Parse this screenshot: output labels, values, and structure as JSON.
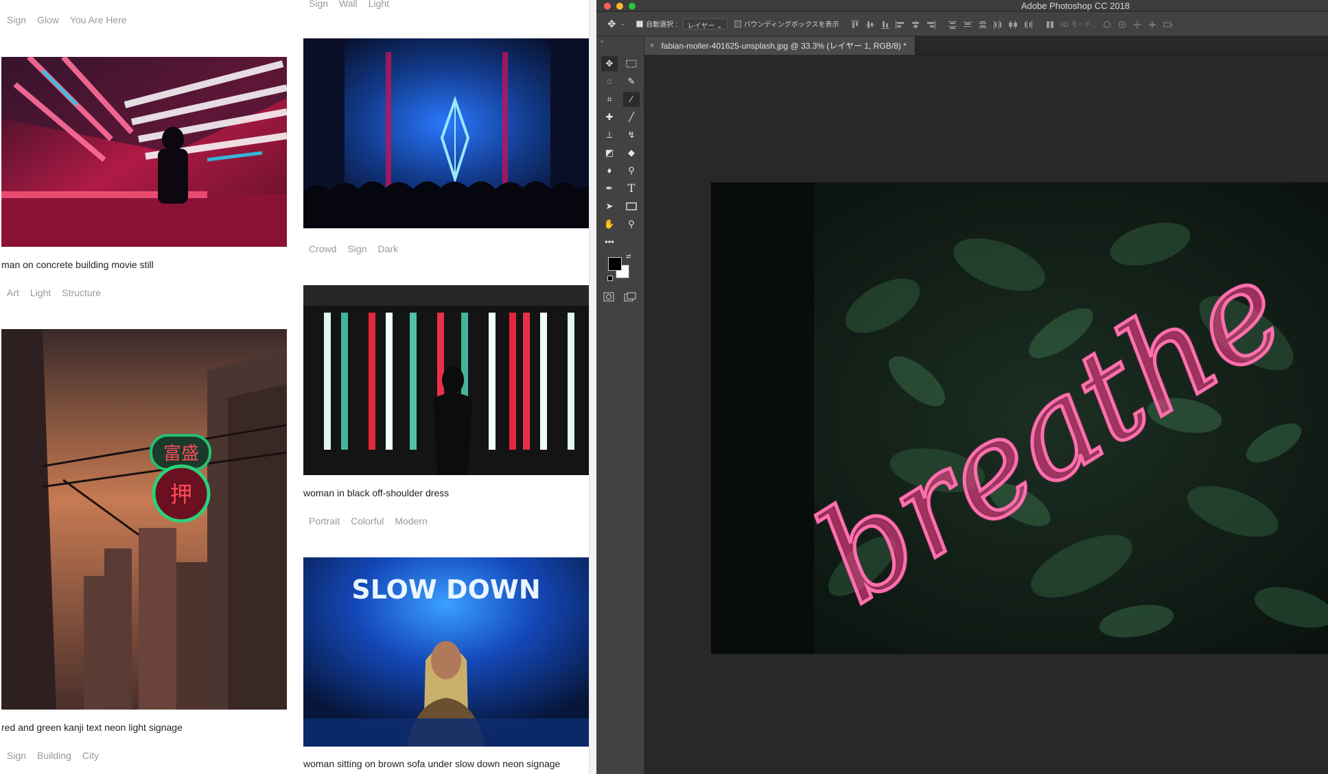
{
  "gallery": {
    "left_column": {
      "top_tags": [
        "Sign",
        "Glow",
        "You Are Here"
      ],
      "items": [
        {
          "caption": "man on concrete building movie still",
          "tags": [
            "Art",
            "Light",
            "Structure"
          ]
        },
        {
          "caption": "red and green kanji text neon light signage",
          "tags": [
            "Sign",
            "Building",
            "City"
          ]
        }
      ]
    },
    "right_column": {
      "top_tags": [
        "Sign",
        "Wall",
        "Light"
      ],
      "items": [
        {
          "tags": [
            "Crowd",
            "Sign",
            "Dark"
          ]
        },
        {
          "caption": "woman in black off-shoulder dress",
          "tags": [
            "Portrait",
            "Colorful",
            "Modern"
          ]
        },
        {
          "caption": "woman sitting on brown sofa under slow down neon signage",
          "sign_text": "SLOW DOWN"
        }
      ]
    }
  },
  "photoshop": {
    "title": "Adobe Photoshop CC 2018",
    "options_bar": {
      "auto_select_label": "自動選択 :",
      "auto_select_value": "レイヤー",
      "bounding_box_label": "バウンディングボックスを表示",
      "mode_3d_label": "3D モード :"
    },
    "document_tab": "fabian-moller-401625-unsplash.jpg @ 33.3% (レイヤー 1, RGB/8) *",
    "canvas_text": "breathe",
    "colors": {
      "foreground": "#000000",
      "background": "#ffffff",
      "neon": "#ff3d8e"
    },
    "tools": [
      "move-icon",
      "marquee-icon",
      "lasso-icon",
      "quick-select-icon",
      "crop-icon",
      "eyedropper-icon",
      "healing-icon",
      "brush-icon",
      "stamp-icon",
      "history-brush-icon",
      "eraser-icon",
      "bucket-icon",
      "blur-icon",
      "dodge-icon",
      "pen-icon",
      "type-icon",
      "path-select-icon",
      "rectangle-icon",
      "hand-icon",
      "zoom-icon",
      "more-icon"
    ]
  }
}
